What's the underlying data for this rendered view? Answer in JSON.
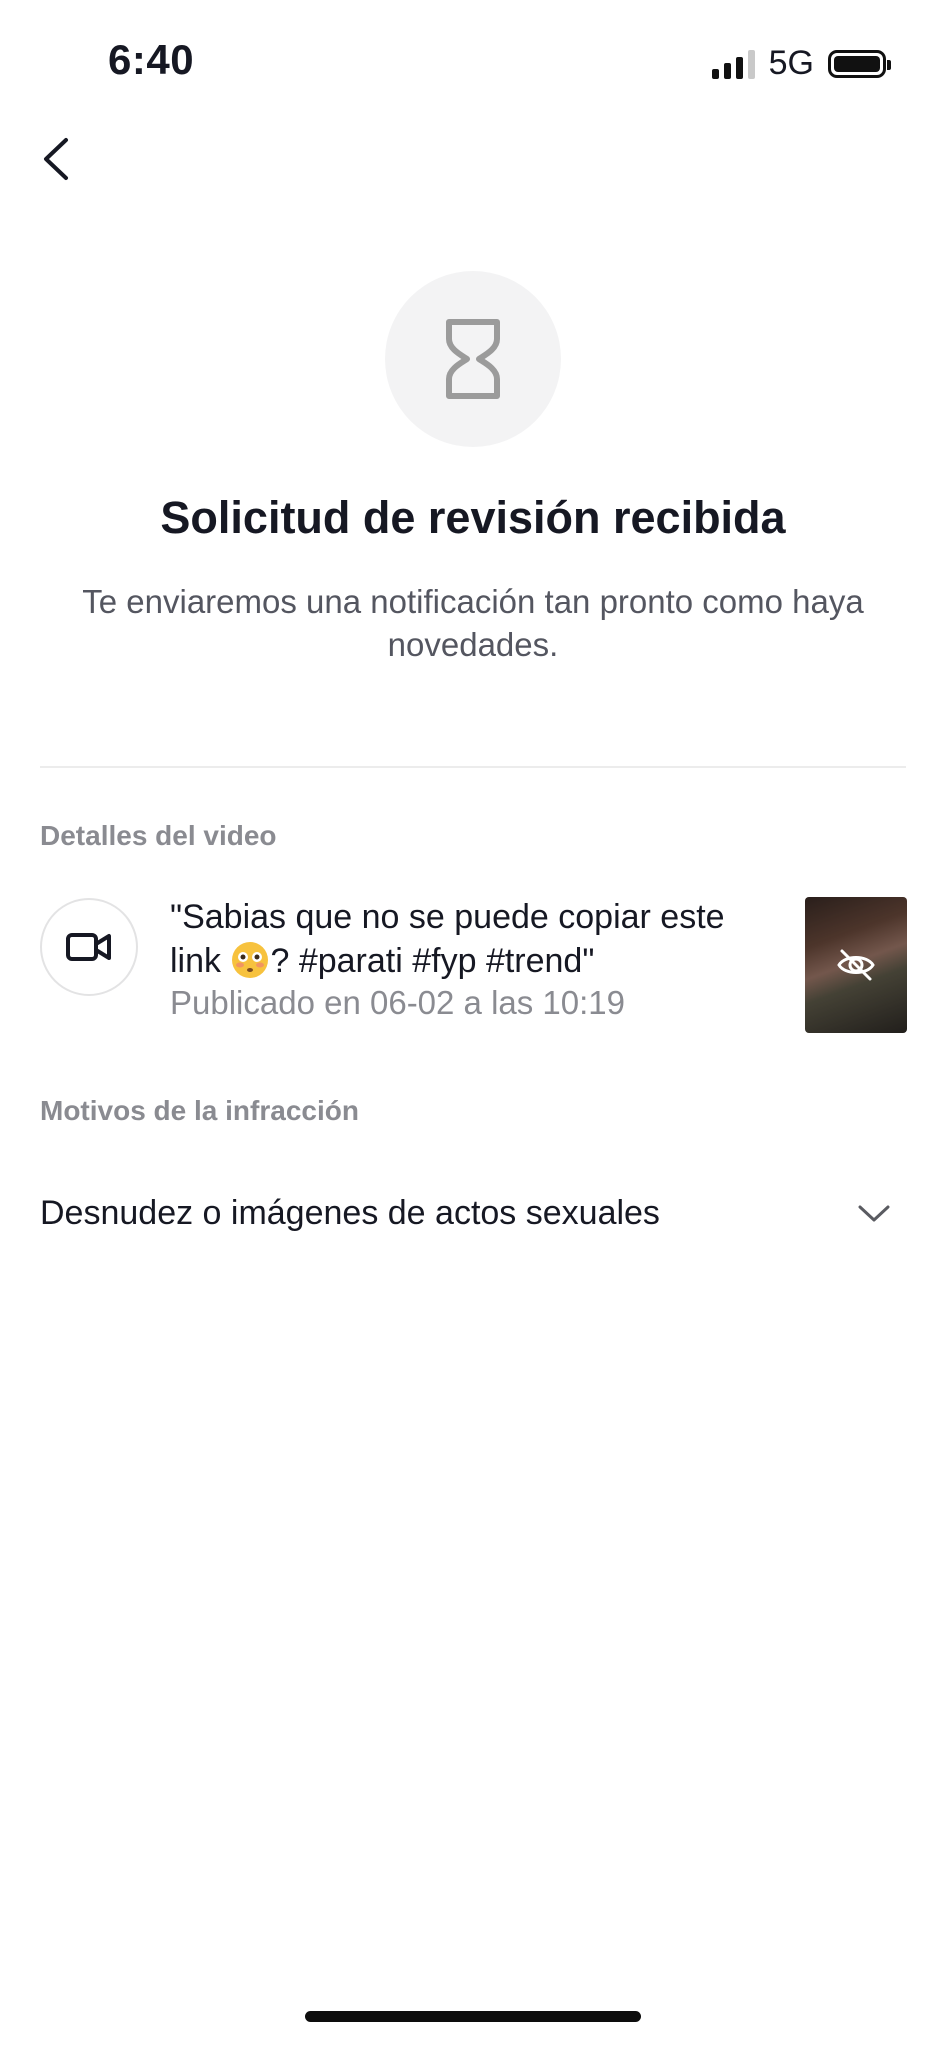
{
  "status_bar": {
    "time": "6:40",
    "network": "5G"
  },
  "header": {
    "back_icon": "chevron-left-icon"
  },
  "hero": {
    "icon": "hourglass-icon",
    "title": "Solicitud de revisión recibida",
    "subtitle": "Te enviaremos una notificación tan pronto como haya novedades."
  },
  "video_details": {
    "section_label": "Detalles del video",
    "icon": "video-camera-icon",
    "caption_part1": "\"Sabias que no se puede copiar este link ",
    "caption_emoji": "flushed-face-emoji",
    "caption_part2": "? #parati #fyp #trend\"",
    "published": "Publicado en 06-02 a las 10:19",
    "thumbnail_icon": "eye-off-icon"
  },
  "violation": {
    "section_label": "Motivos de la infracción",
    "reason": "Desnudez o imágenes de actos sexuales",
    "expand_icon": "chevron-down-icon"
  },
  "colors": {
    "primary_text": "#161823",
    "secondary_text": "#545660",
    "muted_text": "#8a8b91",
    "hero_circle_bg": "#f3f3f4",
    "divider": "#ececec"
  }
}
